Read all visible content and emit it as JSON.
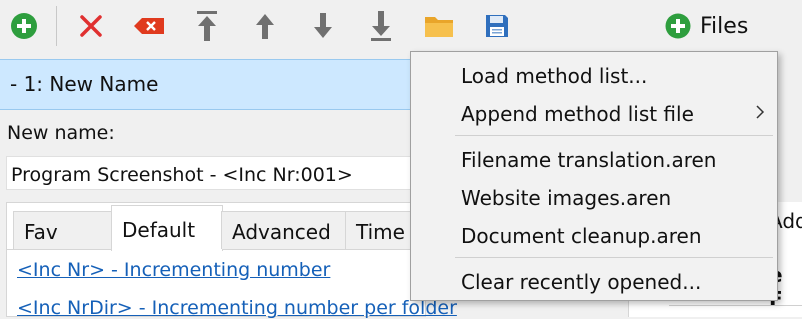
{
  "toolbar": {
    "buttons": [
      {
        "name": "add-method-button",
        "icon": "plus-circle-icon",
        "color": "#2e9e3e"
      },
      {
        "name": "delete-button",
        "icon": "red-x-icon",
        "color": "#e03030"
      },
      {
        "name": "clear-button",
        "icon": "backspace-clear-icon",
        "color": "#e03a1e"
      },
      {
        "name": "move-top-button",
        "icon": "arrow-to-top-icon",
        "color": "#707070"
      },
      {
        "name": "move-up-button",
        "icon": "arrow-up-icon",
        "color": "#707070"
      },
      {
        "name": "move-down-button",
        "icon": "arrow-down-icon",
        "color": "#707070"
      },
      {
        "name": "move-bottom-button",
        "icon": "arrow-to-bottom-icon",
        "color": "#707070"
      },
      {
        "name": "open-folder-button",
        "icon": "folder-icon",
        "color": "#f2b437"
      },
      {
        "name": "save-button",
        "icon": "floppy-disk-icon",
        "color": "#2f6fbd"
      }
    ],
    "files_label": "Files"
  },
  "method": {
    "header": "-  1: New Name",
    "new_name_label": "New name:",
    "new_name_value": "Program Screenshot - <Inc Nr:001>"
  },
  "tabs": [
    "Fav",
    "Default",
    "Advanced",
    "Time"
  ],
  "tokens": [
    "<Inc Nr> - Incrementing number",
    "<Inc NrDir> - Incrementing number per folder"
  ],
  "right_panel": {
    "tab_partial": "Add",
    "heading_partial": "e F"
  },
  "menu": {
    "items": [
      {
        "label": "Load method list...",
        "submenu": false
      },
      {
        "label": "Append method list file",
        "submenu": true
      },
      {
        "label": "Filename translation.aren",
        "submenu": false
      },
      {
        "label": "Website images.aren",
        "submenu": false
      },
      {
        "label": "Document cleanup.aren",
        "submenu": false
      },
      {
        "label": "Clear recently opened...",
        "submenu": false
      }
    ]
  },
  "colors": {
    "accent_green": "#2e9e3e",
    "header_bg": "#cde8ff",
    "link": "#1560b8"
  }
}
